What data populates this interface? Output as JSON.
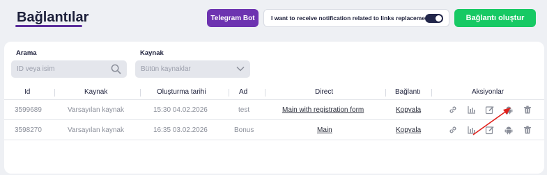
{
  "header": {
    "title": "Bağlantılar",
    "telegram_button": "Telegram Bot",
    "notification_text": "I want to receive notification related to links replacement",
    "notification_enabled": true,
    "create_button": "Bağlantı oluştur"
  },
  "filters": {
    "search_label": "Arama",
    "search_placeholder": "ID veya isim",
    "source_label": "Kaynak",
    "source_selected": "Bütün kaynaklar"
  },
  "table": {
    "columns": [
      "Id",
      "Kaynak",
      "Oluşturma tarihi",
      "Ad",
      "Direct",
      "Bağlantı",
      "Aksiyonlar"
    ],
    "rows": [
      {
        "id": "3599689",
        "source": "Varsayılan kaynak",
        "created": "15:30 04.02.2026",
        "name": "test",
        "direct": "Main with registration form",
        "link": "Kopyala"
      },
      {
        "id": "3598270",
        "source": "Varsayılan kaynak",
        "created": "16:35 03.02.2026",
        "name": "Bonus",
        "direct": "Main",
        "link": "Kopyala"
      }
    ],
    "action_icons": [
      "link-icon",
      "stats-icon",
      "edit-icon",
      "android-icon",
      "trash-icon"
    ]
  },
  "colors": {
    "accent_purple": "#6d33b0",
    "create_green": "#17c964",
    "annotation_arrow": "#e0201b"
  }
}
